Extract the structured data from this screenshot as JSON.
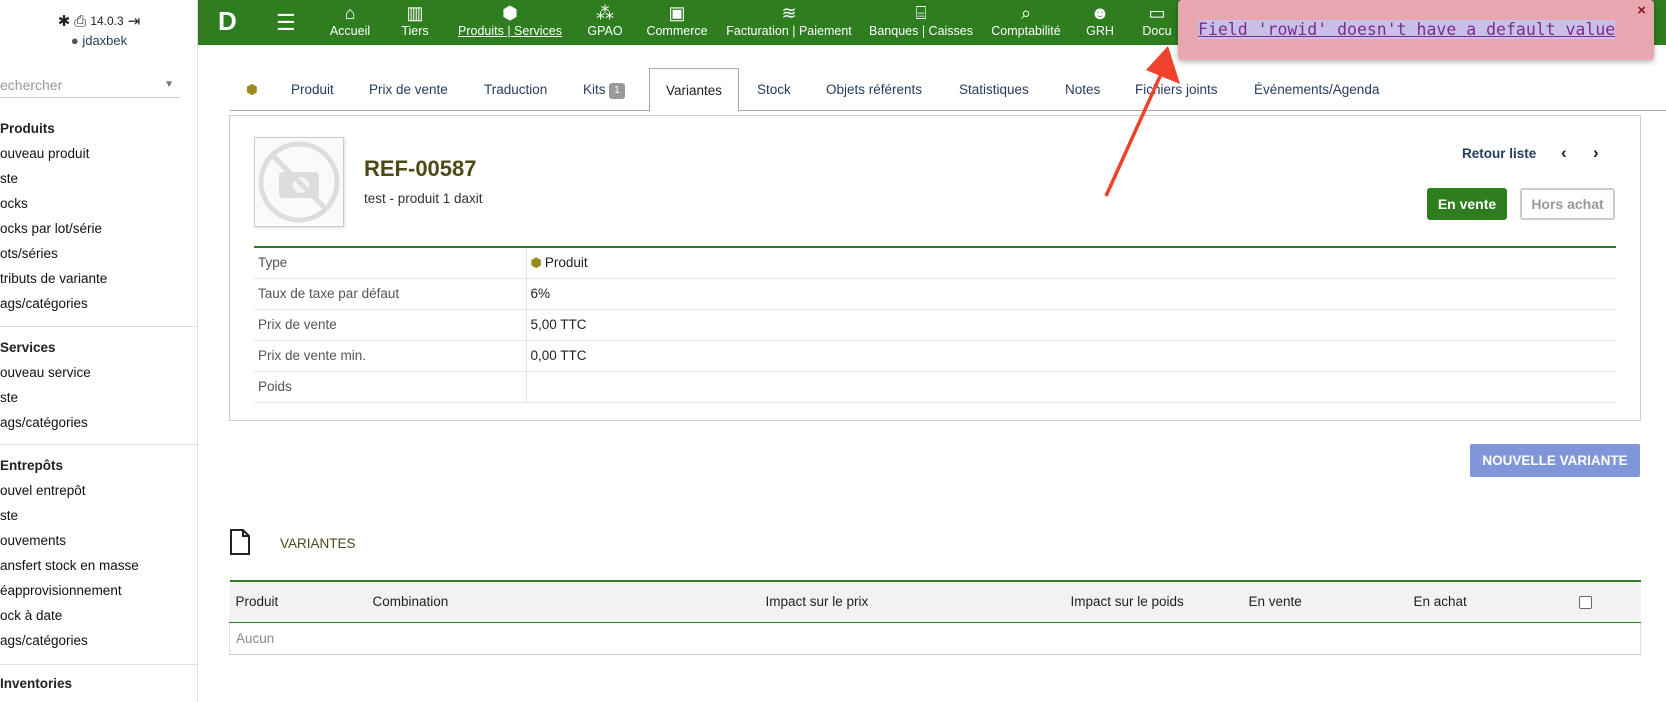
{
  "login": {
    "version": "14.0.3",
    "username": "jdaxbek"
  },
  "search": {
    "placeholder": "echercher"
  },
  "sidebar": {
    "produits": {
      "head": "Produits",
      "items": [
        "ouveau produit",
        "ste",
        "ocks",
        "ocks par lot/série",
        "ots/séries",
        "tributs de variante",
        "ags/catégories"
      ]
    },
    "services": {
      "head": "Services",
      "items": [
        "ouveau service",
        "ste",
        "ags/catégories"
      ]
    },
    "entrepots": {
      "head": "Entrepôts",
      "items": [
        "ouvel entrepôt",
        "ste",
        "ouvements",
        "ansfert stock en masse",
        "éapprovisionnement",
        "ock à date",
        "ags/catégories"
      ]
    },
    "inventories": {
      "head": "Inventories"
    }
  },
  "topnav": [
    {
      "label": "Accueil",
      "icon": "home-icon"
    },
    {
      "label": "Tiers",
      "icon": "building-icon"
    },
    {
      "label": "Produits | Services",
      "icon": "cube-icon"
    },
    {
      "label": "GPAO",
      "icon": "cubes-icon"
    },
    {
      "label": "Commerce",
      "icon": "briefcase-icon"
    },
    {
      "label": "Facturation | Paiement",
      "icon": "coins-icon"
    },
    {
      "label": "Banques | Caisses",
      "icon": "bank-icon"
    },
    {
      "label": "Comptabilité",
      "icon": "search-dollar-icon"
    },
    {
      "label": "GRH",
      "icon": "user-tie-icon"
    },
    {
      "label": "Docu",
      "icon": "folder-icon"
    }
  ],
  "tabs": [
    {
      "label": "Produit"
    },
    {
      "label": "Prix de vente"
    },
    {
      "label": "Traduction"
    },
    {
      "label": "Kits",
      "badge": "1"
    },
    {
      "label": "Variantes"
    },
    {
      "label": "Stock"
    },
    {
      "label": "Objets référents"
    },
    {
      "label": "Statistiques"
    },
    {
      "label": "Notes"
    },
    {
      "label": "Fichiers joints"
    },
    {
      "label": "Événements/Agenda"
    }
  ],
  "product": {
    "ref": "REF-00587",
    "label": "test - produit 1 daxit",
    "retour": "Retour liste",
    "status_sell": "En vente",
    "status_buy": "Hors achat"
  },
  "properties": [
    {
      "key": "Type",
      "value": "Produit"
    },
    {
      "key": "Taux de taxe par défaut",
      "value": "6%"
    },
    {
      "key": "Prix de vente",
      "value": "5,00 TTC"
    },
    {
      "key": "Prix de vente min.",
      "value": "0,00 TTC"
    },
    {
      "key": "Poids",
      "value": ""
    }
  ],
  "actions": {
    "new_variant": "NOUVELLE VARIANTE"
  },
  "variants": {
    "title": "VARIANTES",
    "columns": [
      "Produit",
      "Combination",
      "Impact sur le prix",
      "Impact sur le poids",
      "En vente",
      "En achat"
    ],
    "empty": "Aucun"
  },
  "popup": {
    "message": "Field 'rowid' doesn't have a default value",
    "close": "×"
  },
  "colors": {
    "topbar": "#2e7d1f",
    "accent_blue": "#8096db",
    "popup_bg": "#e8a6b0",
    "annotation_arrow": "#f0412a"
  }
}
